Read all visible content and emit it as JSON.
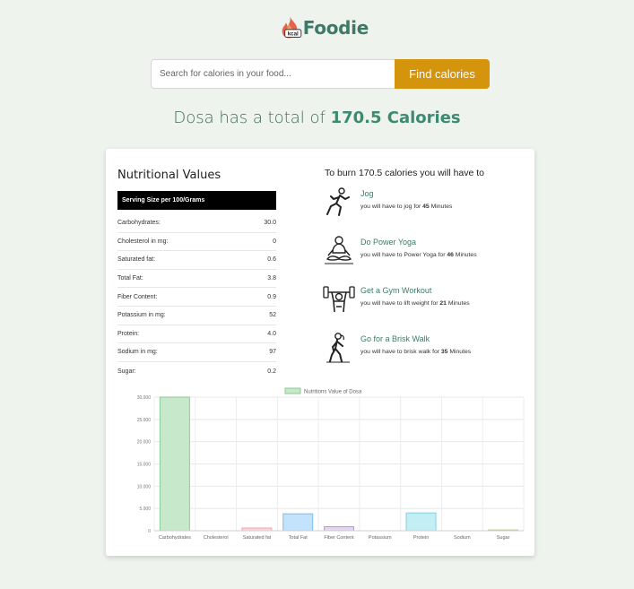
{
  "brand": {
    "name": "Foodie",
    "badge": "kcal"
  },
  "search": {
    "placeholder": "Search for calories in your food...",
    "button_label": "Find calories"
  },
  "headline": {
    "prefix": "Dosa has a total of ",
    "calories": "170.5 Calories"
  },
  "nutrition": {
    "title": "Nutritional Values",
    "serving_size": "Serving Size per 100/Grams",
    "rows": [
      {
        "label": "Carbohydrates:",
        "value": "30.0"
      },
      {
        "label": "Cholesterol in mg:",
        "value": "0"
      },
      {
        "label": "Saturated fat:",
        "value": "0.6"
      },
      {
        "label": "Total Fat:",
        "value": "3.8"
      },
      {
        "label": "Fiber Content:",
        "value": "0.9"
      },
      {
        "label": "Potassium in mg:",
        "value": "52"
      },
      {
        "label": "Protein:",
        "value": "4.0"
      },
      {
        "label": "Sodium in mg:",
        "value": "97"
      },
      {
        "label": "Sugar:",
        "value": "0.2"
      }
    ]
  },
  "burn": {
    "title": "To burn 170.5 calories you will have to",
    "activities": [
      {
        "name": "Jog",
        "desc_before": "you will have to jog for ",
        "amount": "45",
        "desc_after": " Minutes",
        "icon": "jogging-icon"
      },
      {
        "name": "Do Power Yoga",
        "desc_before": "you will have to Power Yoga for ",
        "amount": "46",
        "desc_after": " Minutes",
        "icon": "yoga-icon"
      },
      {
        "name": "Get a Gym Workout",
        "desc_before": "you will have to lift weight for ",
        "amount": "21",
        "desc_after": " Minutes",
        "icon": "weightlifting-icon"
      },
      {
        "name": "Go for a Brisk Walk",
        "desc_before": "you will have to brisk walk for ",
        "amount": "35",
        "desc_after": " Minutes",
        "icon": "walking-icon"
      }
    ]
  },
  "colors": {
    "brand_green": "#3d7a68",
    "accent_orange": "#d4940b",
    "background": "#eef3ed"
  },
  "chart_data": {
    "type": "bar",
    "legend": "Nutritions Value of Dosa",
    "legend_position": "top",
    "categories": [
      "Carbohydrates",
      "Cholesterol",
      "Saturated fat",
      "Total Fat",
      "Fiber Content",
      "Potassium",
      "Protein",
      "Sodium",
      "Sugar"
    ],
    "values": [
      30,
      0,
      0.6,
      3.8,
      0.9,
      0,
      4.0,
      0,
      0.2
    ],
    "bar_colors": [
      "#c8e8cb",
      "#ffd7dc",
      "#ffd7dc",
      "#c3e2fb",
      "#e4d6ef",
      "#e6e6e6",
      "#c3eef3",
      "#e6e6e6",
      "#e8ecd0"
    ],
    "border_colors": [
      "#8dca94",
      "#f0a0ad",
      "#f0a0ad",
      "#7fbde8",
      "#b99ad4",
      "#cccccc",
      "#82d2de",
      "#cccccc",
      "#c7cf9a"
    ],
    "yticks": [
      "0",
      "5.000",
      "10.000",
      "15.000",
      "20.000",
      "25.000",
      "30.000"
    ],
    "ylim": [
      0,
      30
    ],
    "grid": true
  }
}
